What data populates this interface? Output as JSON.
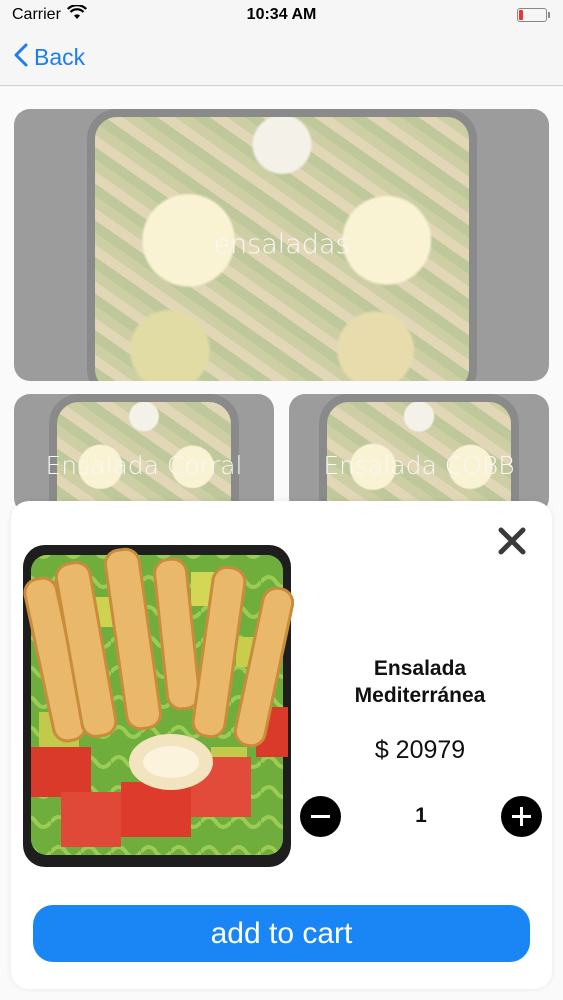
{
  "status_bar": {
    "carrier": "Carrier",
    "time": "10:34 AM",
    "battery_color": "#e33333"
  },
  "nav": {
    "back_label": "Back",
    "accent_color": "#1a7cf6"
  },
  "categories": {
    "main_card": {
      "label": "ensaladas"
    },
    "items": [
      {
        "label": "Ensalada Corral"
      },
      {
        "label": "Ensalada COBB"
      }
    ]
  },
  "modal": {
    "product_name": "Ensalada Mediterránea",
    "price": "$ 20979",
    "quantity": "1",
    "add_to_cart_label": "add to cart",
    "button_color": "#1a86f6",
    "icons": {
      "close": "close-icon",
      "decrease": "minus-circle-icon",
      "increase": "plus-circle-icon"
    }
  }
}
